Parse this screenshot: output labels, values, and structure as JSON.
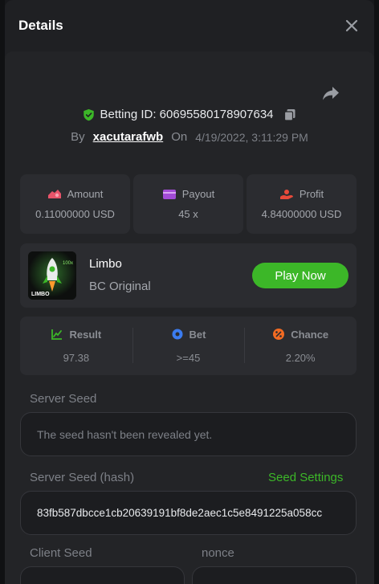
{
  "modal": {
    "title": "Details"
  },
  "bet": {
    "id_label": "Betting ID: 60695580178907634",
    "by_label": "By",
    "username": "xacutarafwb",
    "on_label": "On",
    "date": "4/19/2022, 3:11:29 PM"
  },
  "stats": [
    {
      "label": "Amount",
      "value": "0.11000000 USD",
      "icon": "amount-icon",
      "color": "#e8546a"
    },
    {
      "label": "Payout",
      "value": "45 x",
      "icon": "wallet-icon",
      "color": "#a24bd6"
    },
    {
      "label": "Profit",
      "value": "4.84000000 USD",
      "icon": "profit-hand-icon",
      "color": "#e84a3a"
    }
  ],
  "game": {
    "name": "Limbo",
    "type": "BC Original",
    "play_label": "Play Now",
    "thumbnail_text": "LIMBO",
    "thumbnail_badge": "100x"
  },
  "results": [
    {
      "label": "Result",
      "value": "97.38",
      "icon": "result-chart-icon",
      "color": "#3cb728"
    },
    {
      "label": "Bet",
      "value": ">=45",
      "icon": "bet-coin-icon",
      "color": "#3b7cf0"
    },
    {
      "label": "Chance",
      "value": "2.20%",
      "icon": "percent-icon",
      "color": "#f36b22"
    }
  ],
  "seeds": {
    "server_seed_label": "Server Seed",
    "server_seed_value": "The seed hasn't been revealed yet.",
    "server_hash_label": "Server Seed (hash)",
    "seed_settings_label": "Seed Settings",
    "server_hash_value": "83fb587dbcce1cb20639191bf8de2aec1c5e8491225a058cc",
    "client_seed_label": "Client Seed",
    "nonce_label": "nonce"
  },
  "colors": {
    "accent": "#3cb728",
    "background": "#232427",
    "card": "#2b2c30"
  }
}
